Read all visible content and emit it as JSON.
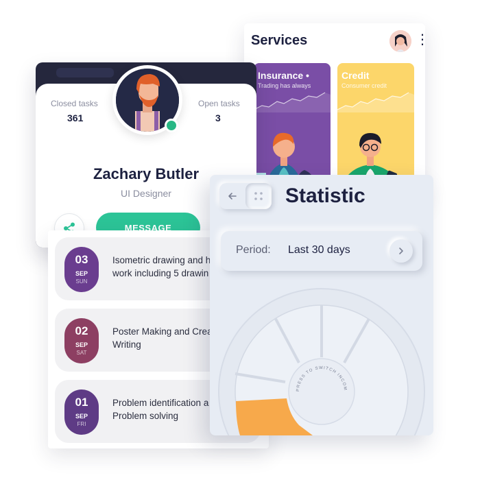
{
  "services": {
    "title": "Services",
    "more": "⋮",
    "insurance": {
      "title": "Insurance",
      "subtitle": "Trading has always"
    },
    "credit": {
      "title": "Credit",
      "subtitle": "Consumer credit"
    }
  },
  "profile": {
    "closed_label": "Closed tasks",
    "closed_value": "361",
    "open_label": "Open tasks",
    "open_value": "3",
    "name": "Zachary Butler",
    "role": "UI Designer",
    "message_label": "MESSAGE"
  },
  "tasks": [
    {
      "day": "03",
      "month": "SEP",
      "weekday": "SUN",
      "line1": "Isometric drawing and h",
      "line2": "work including 5 drawin",
      "color": "#6a3d8f"
    },
    {
      "day": "02",
      "month": "SEP",
      "weekday": "SAT",
      "line1": "Poster Making and Crea",
      "line2": "Writing",
      "color": "#8d3f62"
    },
    {
      "day": "01",
      "month": "SEP",
      "weekday": "FRI",
      "line1": "Problem identification a",
      "line2": "Problem solving",
      "color": "#5e3b85"
    }
  ],
  "statistic": {
    "title": "Statistic",
    "period_label": "Period:",
    "period_value": "Last 30 days",
    "dial_caption": "PRESS TO SWITCH INCOME OR OUTCOME",
    "accent_color": "#e8282b",
    "segment_color": "#f7a94b"
  }
}
